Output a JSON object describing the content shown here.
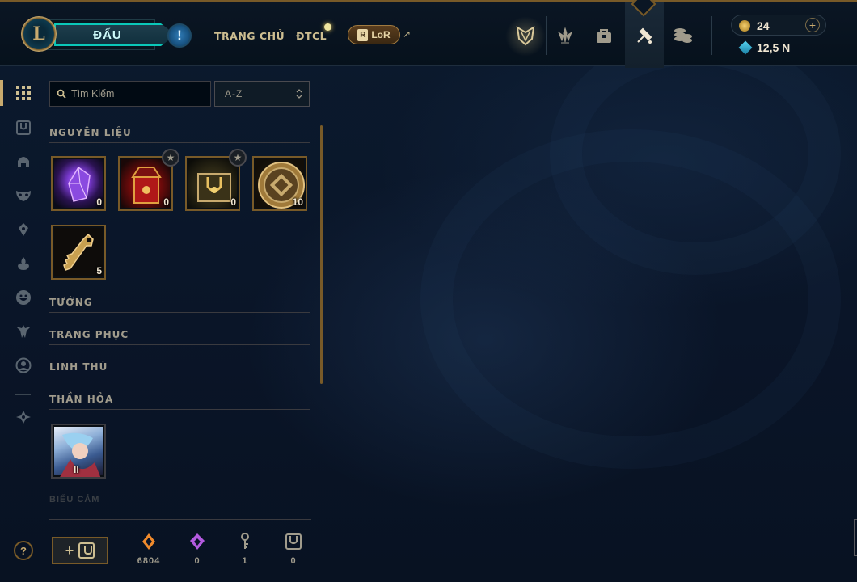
{
  "header": {
    "play_label": "ĐẤU",
    "alert_glyph": "!",
    "nav_home": "TRANG CHỦ",
    "nav_tft": "ĐTCL",
    "lor_label": "LoR",
    "lor_ext_glyph": "↗",
    "icons": [
      "clash-icon",
      "tft-icon",
      "collection-icon",
      "loot-icon",
      "store-icon"
    ],
    "rp_value": "24",
    "be_value": "12,5 N"
  },
  "sidebar": {
    "active_item": "all-loot-icon",
    "items": [
      "all-loot-icon",
      "chest-icon",
      "champion-helmet-icon",
      "skin-mask-icon",
      "ward-icon",
      "summoner-flame-icon",
      "emote-icon",
      "eternals-icon",
      "icon-profile-icon",
      "crafting-icon"
    ]
  },
  "filters": {
    "search_placeholder": "Tìm Kiếm",
    "sort_label": "A-Z"
  },
  "sections": {
    "materials": {
      "label": "NGUYÊN LIỆU",
      "items": [
        {
          "name": "mythic-essence",
          "count": "0"
        },
        {
          "name": "masterwork-chest",
          "count": "0",
          "starred": true
        },
        {
          "name": "hextech-chest",
          "count": "0",
          "starred": true
        },
        {
          "name": "event-token",
          "count": "10"
        },
        {
          "name": "key",
          "count": "5"
        }
      ]
    },
    "champions": {
      "label": "TƯỚNG"
    },
    "skins": {
      "label": "TRANG PHỤC"
    },
    "pets": {
      "label": "LINH THÚ"
    },
    "eternals": {
      "label": "THẦN HỎA",
      "items": [
        {
          "name": "eternal-series",
          "series": "II"
        }
      ]
    },
    "emotes_faded": {
      "label": "BIỂU CẢM"
    }
  },
  "footer": {
    "help_glyph": "?",
    "add_chest_plus": "+",
    "resources": [
      {
        "name": "orange-essence",
        "value": "6804",
        "color": "#f08a2c"
      },
      {
        "name": "mythic-essence",
        "value": "0",
        "color": "#b45ae0"
      },
      {
        "name": "key-fragment",
        "value": "1",
        "color": "#a09b8c"
      },
      {
        "name": "chest",
        "value": "0",
        "color": "#a09b8c"
      }
    ]
  }
}
